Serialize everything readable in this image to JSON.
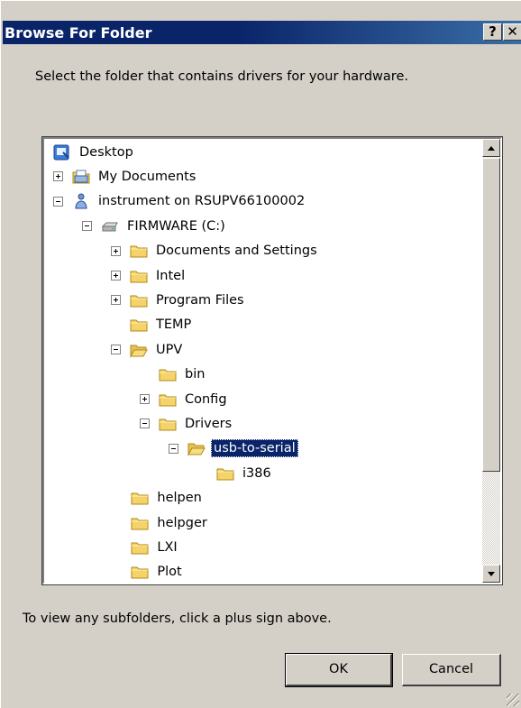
{
  "window": {
    "title": "Browse For Folder",
    "help_button": "?",
    "close_button": "✕"
  },
  "instruction": "Select the folder that contains drivers for your hardware.",
  "tree": [
    {
      "label": "Desktop",
      "icon": "desktop-icon",
      "expander": "none",
      "level": 0,
      "selected": false
    },
    {
      "label": "My Documents",
      "icon": "my-documents-icon",
      "expander": "plus",
      "level": 0,
      "selected": false
    },
    {
      "label": "instrument on RSUPV66100002",
      "icon": "user-computer-icon",
      "expander": "minus",
      "level": 0,
      "selected": false
    },
    {
      "label": "FIRMWARE (C:)",
      "icon": "drive-icon",
      "expander": "minus",
      "level": 1,
      "selected": false
    },
    {
      "label": "Documents and Settings",
      "icon": "folder-icon",
      "expander": "plus",
      "level": 2,
      "selected": false
    },
    {
      "label": "Intel",
      "icon": "folder-icon",
      "expander": "plus",
      "level": 2,
      "selected": false
    },
    {
      "label": "Program Files",
      "icon": "folder-icon",
      "expander": "plus",
      "level": 2,
      "selected": false
    },
    {
      "label": "TEMP",
      "icon": "folder-icon",
      "expander": "none",
      "level": 2,
      "selected": false
    },
    {
      "label": "UPV",
      "icon": "folder-open-icon",
      "expander": "minus",
      "level": 2,
      "selected": false
    },
    {
      "label": "bin",
      "icon": "folder-icon",
      "expander": "none",
      "level": 3,
      "selected": false
    },
    {
      "label": "Config",
      "icon": "folder-icon",
      "expander": "plus",
      "level": 3,
      "selected": false
    },
    {
      "label": "Drivers",
      "icon": "folder-icon",
      "expander": "minus",
      "level": 3,
      "selected": false
    },
    {
      "label": "usb-to-serial",
      "icon": "folder-open-icon",
      "expander": "minus",
      "level": 4,
      "selected": true
    },
    {
      "label": "i386",
      "icon": "folder-icon",
      "expander": "none",
      "level": 5,
      "selected": false
    },
    {
      "label": "helpen",
      "icon": "folder-icon",
      "expander": "none",
      "level": 2.7,
      "selected": false
    },
    {
      "label": "helpger",
      "icon": "folder-icon",
      "expander": "none",
      "level": 2.7,
      "selected": false
    },
    {
      "label": "LXI",
      "icon": "folder-icon",
      "expander": "none",
      "level": 2.7,
      "selected": false
    },
    {
      "label": "Plot",
      "icon": "folder-icon",
      "expander": "none",
      "level": 2.7,
      "selected": false
    }
  ],
  "scrollbar": {
    "up_icon": "scroll-up-arrow-icon",
    "down_icon": "scroll-down-arrow-icon"
  },
  "hint": "To view any subfolders, click a plus sign above.",
  "buttons": {
    "ok": "OK",
    "cancel": "Cancel"
  },
  "colors": {
    "title_bar": "#0a246a",
    "selection": "#0a246a",
    "dialog_face": "#d4d0c8"
  }
}
